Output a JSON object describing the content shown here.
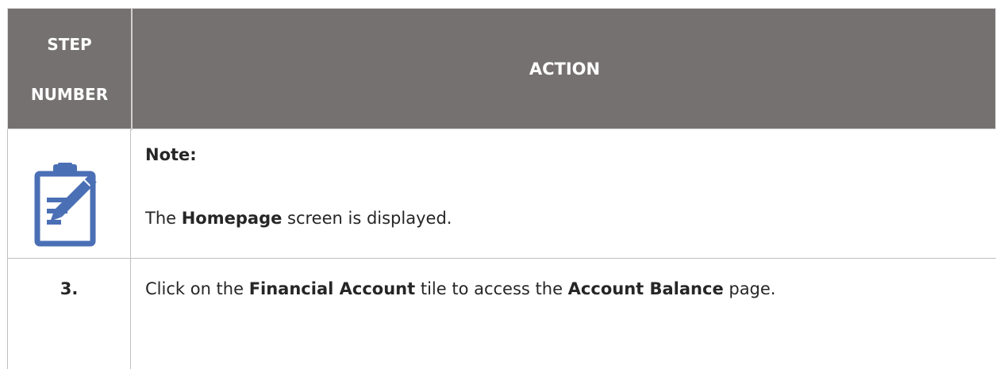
{
  "header": {
    "step_line1": "STEP",
    "step_line2": "NUMBER",
    "action": "ACTION"
  },
  "note_row": {
    "icon": "clipboard-edit-icon",
    "title": "Note:",
    "text_pre": "The ",
    "text_bold": "Homepage",
    "text_post": " screen is displayed."
  },
  "step_row": {
    "number": "3.",
    "text_1": "Click on the ",
    "bold_1": "Financial Account",
    "text_2": " tile to access the ",
    "bold_2": "Account Balance",
    "text_3": " page."
  },
  "colors": {
    "header_bg": "#767171",
    "header_text": "#ffffff",
    "icon_blue": "#4a6fb5",
    "body_text": "#262626"
  }
}
